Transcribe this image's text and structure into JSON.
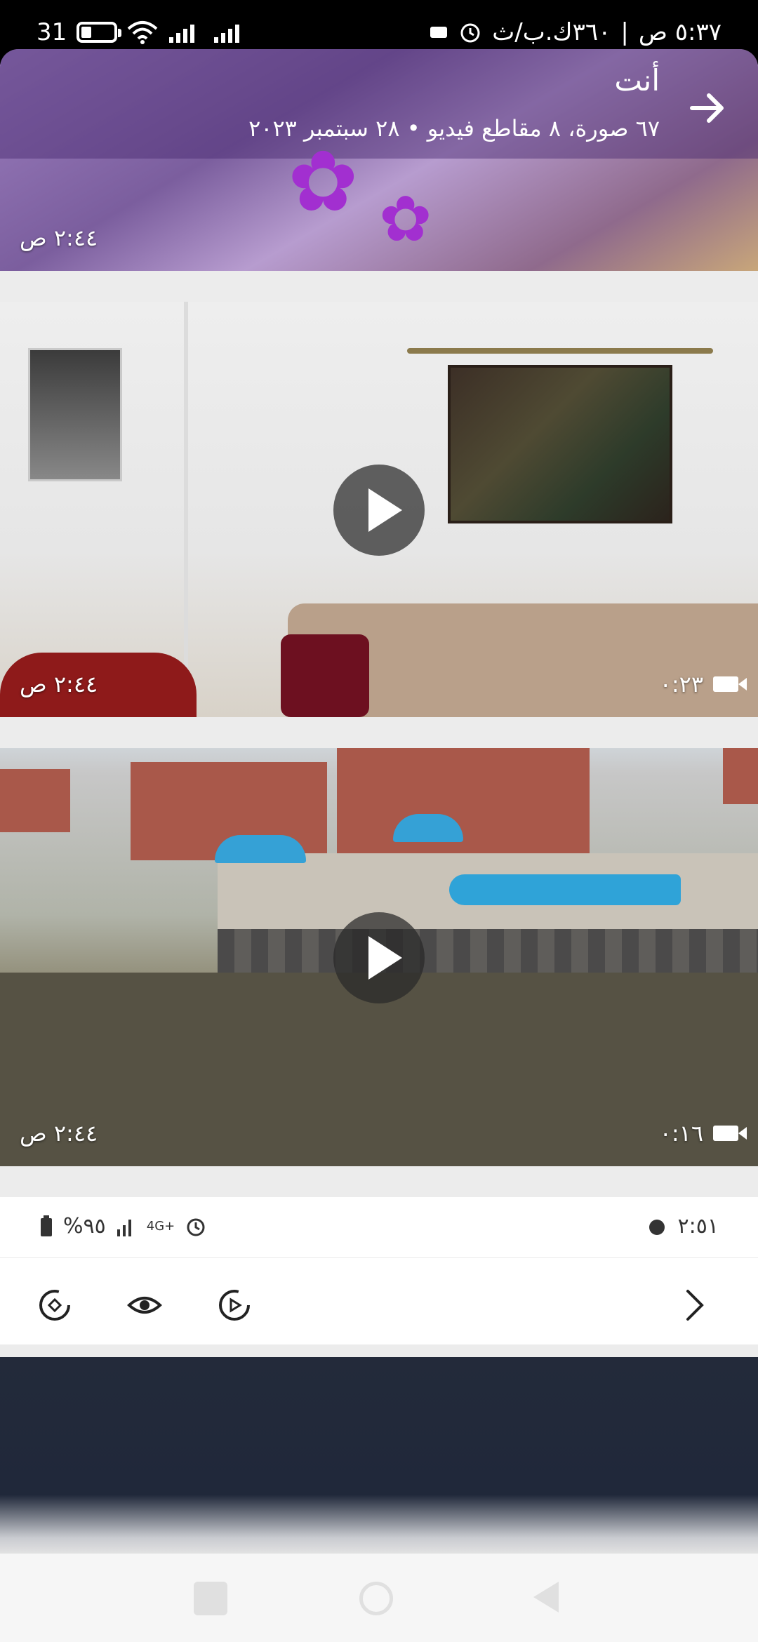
{
  "status_bar": {
    "signal_label": "31",
    "clock": "٥:٣٧ ص",
    "speed": "٣٦٠ك.ب/ث",
    "icons": [
      "battery-icon",
      "wifi-icon",
      "signal-icon",
      "alarm-icon",
      "notification-icon"
    ]
  },
  "album": {
    "title": "أنت",
    "subtitle": "٦٧ صورة، ٨ مقاطع فيديو  •  ٢٨ سبتمبر ٢٠٢٣",
    "first_timestamp": "٢:٤٤ ص"
  },
  "videos": [
    {
      "timestamp": "٢:٤٤ ص",
      "duration": "٠:٢٣"
    },
    {
      "timestamp": "٢:٤٤ ص",
      "duration": "٠:١٦"
    }
  ],
  "panel": {
    "left_status": "%٩٥",
    "network": "4G+",
    "right_time": "٢:٥١"
  },
  "colors": {
    "accent_purple": "#7b5e9e",
    "status_bg": "#000000",
    "panel_bg": "#ffffff"
  }
}
